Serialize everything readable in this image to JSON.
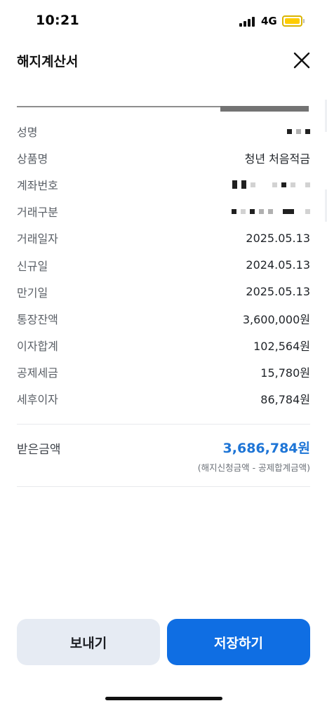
{
  "status_bar": {
    "time": "10:21",
    "network": "4G",
    "battery_color": "#ffcc00"
  },
  "header": {
    "title": "해지계산서",
    "close_icon": "close-icon"
  },
  "scroll_progress": 0.3,
  "rows": [
    {
      "label": "성명",
      "value": "",
      "masked": true
    },
    {
      "label": "상품명",
      "value": "청년 처음적금",
      "masked": false
    },
    {
      "label": "계좌번호",
      "value": "",
      "masked": true
    },
    {
      "label": "거래구분",
      "value": "",
      "masked": true
    },
    {
      "label": "거래일자",
      "value": "2025.05.13",
      "masked": false
    },
    {
      "label": "신규일",
      "value": "2024.05.13",
      "masked": false
    },
    {
      "label": "만기일",
      "value": "2025.05.13",
      "masked": false
    },
    {
      "label": "통장잔액",
      "value": "3,600,000원",
      "masked": false
    },
    {
      "label": "이자합계",
      "value": "102,564원",
      "masked": false
    },
    {
      "label": "공제세금",
      "value": "15,780원",
      "masked": false
    },
    {
      "label": "세후이자",
      "value": "86,784원",
      "masked": false
    }
  ],
  "received": {
    "label": "받은금액",
    "amount": "3,686,784원",
    "note": "(해지신청금액 - 공제합계금액)",
    "accent_color": "#1e75d6"
  },
  "actions": {
    "send_label": "보내기",
    "save_label": "저장하기",
    "primary_color": "#0f6ee3"
  }
}
